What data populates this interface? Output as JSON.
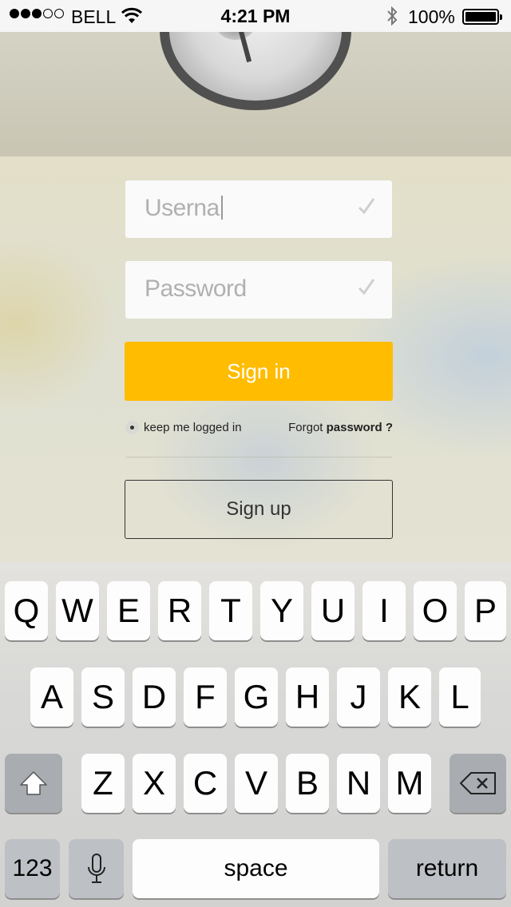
{
  "status_bar": {
    "signal_dots": [
      true,
      true,
      true,
      false,
      false
    ],
    "carrier": "BELL",
    "time": "4:21 PM",
    "battery": "100%"
  },
  "login": {
    "username_value": "Userna",
    "password_placeholder": "Password",
    "signin_label": "Sign in",
    "remember_label": "keep me logged in",
    "forgot_prefix": "Forgot",
    "forgot_bold": "password ?",
    "signup_label": "Sign up"
  },
  "colors": {
    "accent": "#ffbc00"
  },
  "keyboard": {
    "row1": [
      "Q",
      "W",
      "E",
      "R",
      "T",
      "Y",
      "U",
      "I",
      "O",
      "P"
    ],
    "row2": [
      "A",
      "S",
      "D",
      "F",
      "G",
      "H",
      "J",
      "K",
      "L"
    ],
    "row3": [
      "Z",
      "X",
      "C",
      "V",
      "B",
      "N",
      "M"
    ],
    "numbers_label": "123",
    "space_label": "space",
    "return_label": "return",
    "shift_icon": "shift-icon",
    "delete_icon": "delete-icon",
    "mic_icon": "microphone-icon"
  }
}
